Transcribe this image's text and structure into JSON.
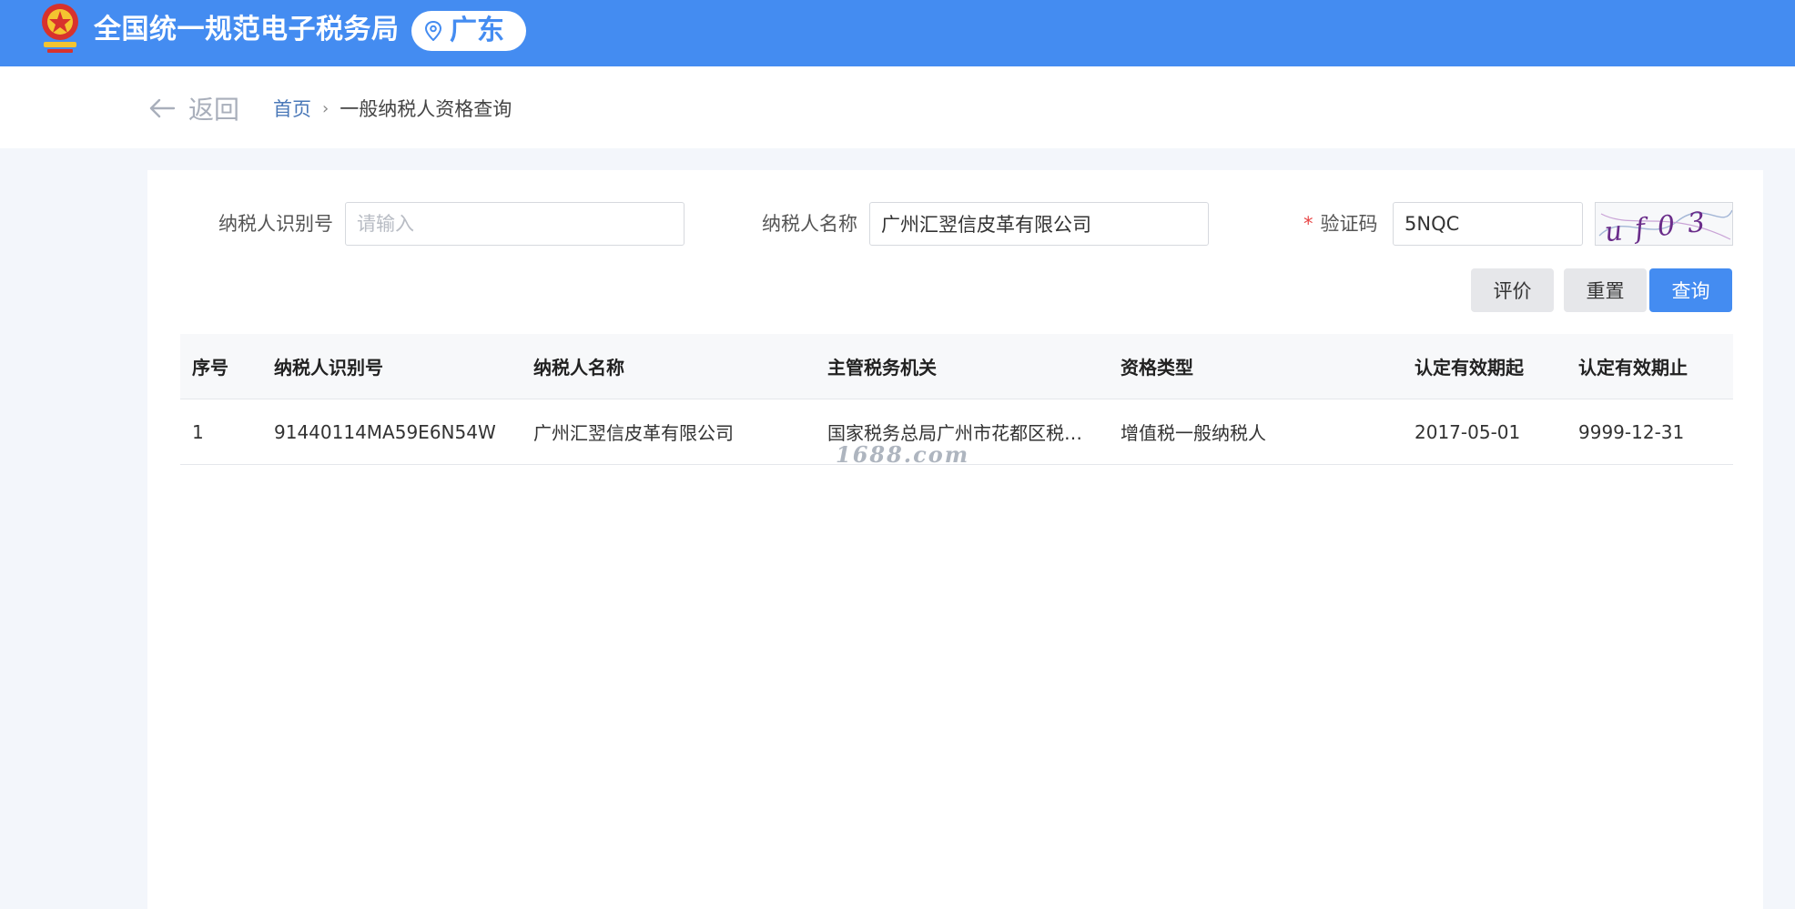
{
  "header": {
    "site_title": "全国统一规范电子税务局",
    "region": "广东",
    "brand_color": "#448cf1"
  },
  "nav": {
    "back_label": "返回",
    "breadcrumb_home": "首页",
    "breadcrumb_separator": "›",
    "breadcrumb_current": "一般纳税人资格查询"
  },
  "form": {
    "taxpayer_id_label": "纳税人识别号",
    "taxpayer_id_value": "",
    "taxpayer_id_placeholder": "请输入",
    "taxpayer_name_label": "纳税人名称",
    "taxpayer_name_value": "广州汇翌信皮革有限公司",
    "required_mark": "*",
    "captcha_label": "验证码",
    "captcha_value": "5NQC",
    "captcha_image_text": "uf03"
  },
  "buttons": {
    "evaluate": "评价",
    "reset": "重置",
    "query": "查询"
  },
  "table": {
    "columns": [
      "序号",
      "纳税人识别号",
      "纳税人名称",
      "主管税务机关",
      "资格类型",
      "认定有效期起",
      "认定有效期止"
    ],
    "rows": [
      [
        "1",
        "91440114MA59E6N54W",
        "广州汇翌信皮革有限公司",
        "国家税务总局广州市花都区税…",
        "增值税一般纳税人",
        "2017-05-01",
        "9999-12-31"
      ]
    ]
  },
  "watermark": "1688.com"
}
